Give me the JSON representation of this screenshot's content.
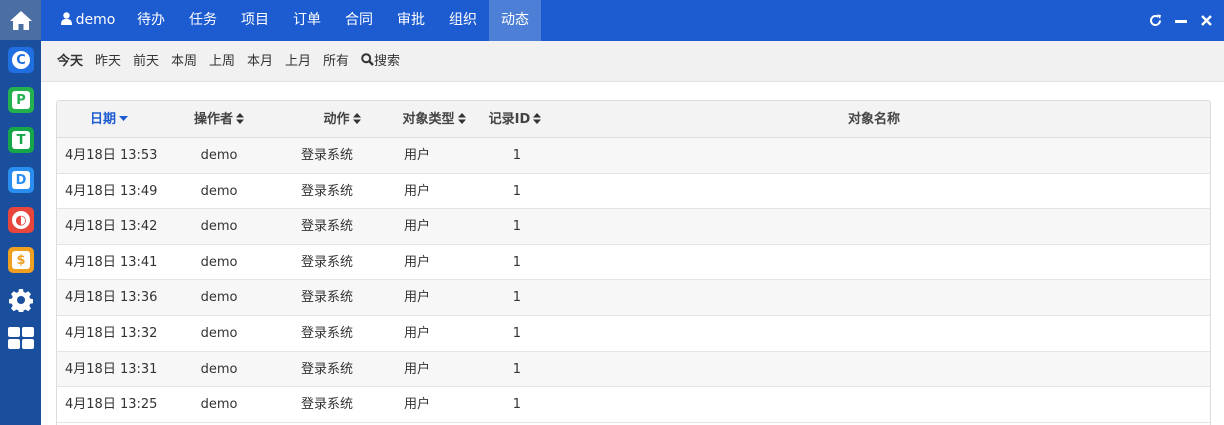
{
  "topnav": {
    "user": "demo",
    "items": [
      "待办",
      "任务",
      "项目",
      "订单",
      "合同",
      "审批",
      "组织",
      "动态"
    ],
    "active": "动态"
  },
  "apps": [
    {
      "name": "C",
      "color": "#1f6fe0"
    },
    {
      "name": "P",
      "color": "#22b14c"
    },
    {
      "name": "T",
      "color": "#16a64a"
    },
    {
      "name": "D",
      "color": "#2a8ef0"
    },
    {
      "name": "◐",
      "color": "#e8453c"
    },
    {
      "name": "$",
      "color": "#f0a020"
    }
  ],
  "subbar": {
    "items": [
      "今天",
      "昨天",
      "前天",
      "本周",
      "上周",
      "本月",
      "上月",
      "所有"
    ],
    "active": "今天",
    "search_label": "搜索"
  },
  "table": {
    "columns": [
      "日期",
      "操作者",
      "动作",
      "对象类型",
      "记录ID",
      "对象名称"
    ],
    "sorted_column": "日期",
    "rows": [
      [
        "4月18日 13:53",
        "demo",
        "登录系统",
        "用户",
        "1",
        ""
      ],
      [
        "4月18日 13:49",
        "demo",
        "登录系统",
        "用户",
        "1",
        ""
      ],
      [
        "4月18日 13:42",
        "demo",
        "登录系统",
        "用户",
        "1",
        ""
      ],
      [
        "4月18日 13:41",
        "demo",
        "登录系统",
        "用户",
        "1",
        ""
      ],
      [
        "4月18日 13:36",
        "demo",
        "登录系统",
        "用户",
        "1",
        ""
      ],
      [
        "4月18日 13:32",
        "demo",
        "登录系统",
        "用户",
        "1",
        ""
      ],
      [
        "4月18日 13:31",
        "demo",
        "登录系统",
        "用户",
        "1",
        ""
      ],
      [
        "4月18日 13:25",
        "demo",
        "登录系统",
        "用户",
        "1",
        ""
      ]
    ]
  },
  "colors": {
    "topnav": "#1c5bd0",
    "appbar": "#1a4f9e",
    "active_nav": "#4d7fd6"
  }
}
